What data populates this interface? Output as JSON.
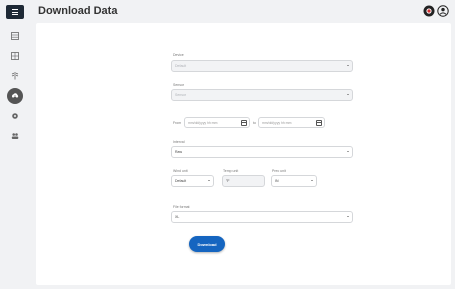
{
  "header": {
    "title": "Download Data"
  },
  "form": {
    "device": {
      "label": "Device",
      "placeholder": "Default"
    },
    "sensor": {
      "label": "Sensor",
      "placeholder": "Sensor"
    },
    "date_range": {
      "from_label": "From",
      "from_placeholder": "mm/dd/yyyy hh:mm",
      "to_label": "to",
      "to_placeholder": "mm/dd/yyyy hh:mm"
    },
    "interval": {
      "label": "Interval",
      "value": "Raw"
    },
    "wind_unit": {
      "label": "Wind unit",
      "value": "Default"
    },
    "temp_unit": {
      "label": "Temp unit",
      "value": "°F"
    },
    "prec_unit": {
      "label": "Prec unit",
      "value": "IN"
    },
    "file_format": {
      "label": "File format",
      "value": "XL"
    }
  },
  "download_label": "Download",
  "colors": {
    "primary": "#1565c0",
    "sidebar_bg": "#1f2a36"
  }
}
